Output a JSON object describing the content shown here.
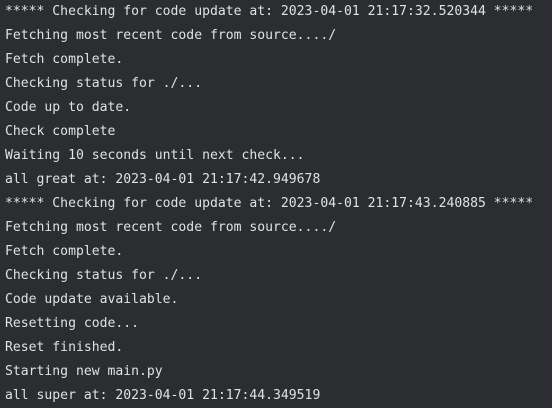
{
  "terminal": {
    "lines": [
      "***** Checking for code update at: 2023-04-01 21:17:32.520344 *****",
      "Fetching most recent code from source..../",
      "Fetch complete.",
      "Checking status for ./...",
      "Code up to date.",
      "Check complete",
      "Waiting 10 seconds until next check...",
      "all great at: 2023-04-01 21:17:42.949678",
      "***** Checking for code update at: 2023-04-01 21:17:43.240885 *****",
      "Fetching most recent code from source..../",
      "Fetch complete.",
      "Checking status for ./...",
      "Code update available.",
      "Resetting code...",
      "Reset finished.",
      "Starting new main.py",
      "all super at: 2023-04-01 21:17:44.349519"
    ],
    "colors": {
      "background": "#2b2d30",
      "text": "#dfe1e5"
    }
  }
}
